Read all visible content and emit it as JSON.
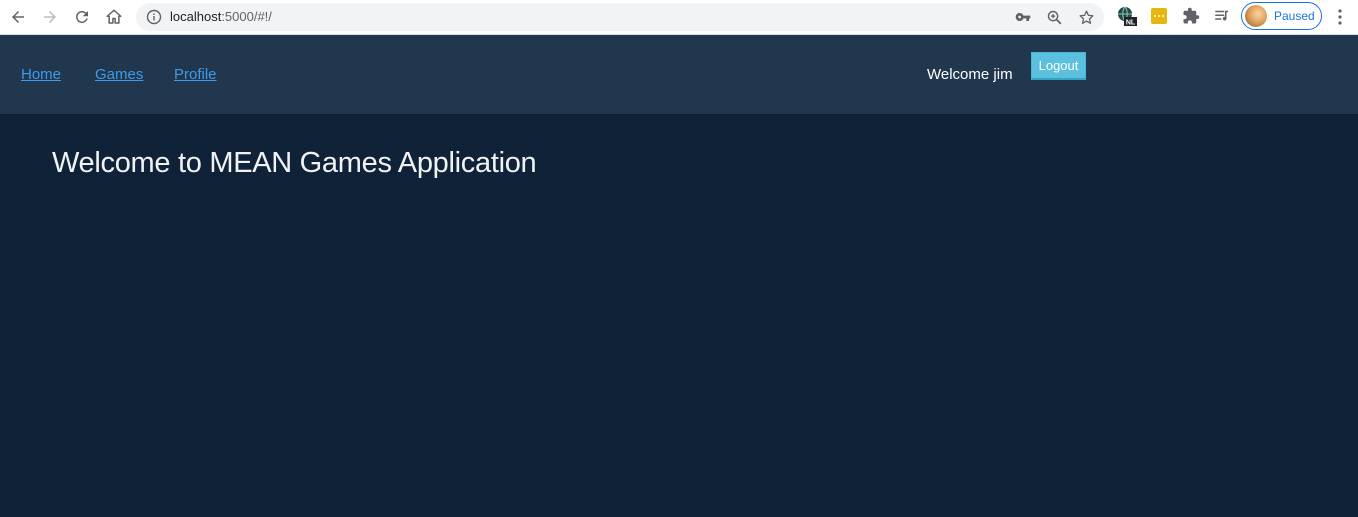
{
  "browser": {
    "url_host": "localhost",
    "url_rest": ":5000/#!/",
    "profile_status": "Paused",
    "extension_badge": "NL"
  },
  "navbar": {
    "links": [
      "Home",
      "Games",
      "Profile"
    ],
    "welcome": "Welcome jim",
    "logout_label": "Logout"
  },
  "main": {
    "title": "Welcome to MEAN Games Application"
  },
  "colors": {
    "navbar_bg": "#21374e",
    "page_bg": "#0f2237",
    "link": "#3d9be9",
    "logout_bg": "#5bc0de"
  }
}
